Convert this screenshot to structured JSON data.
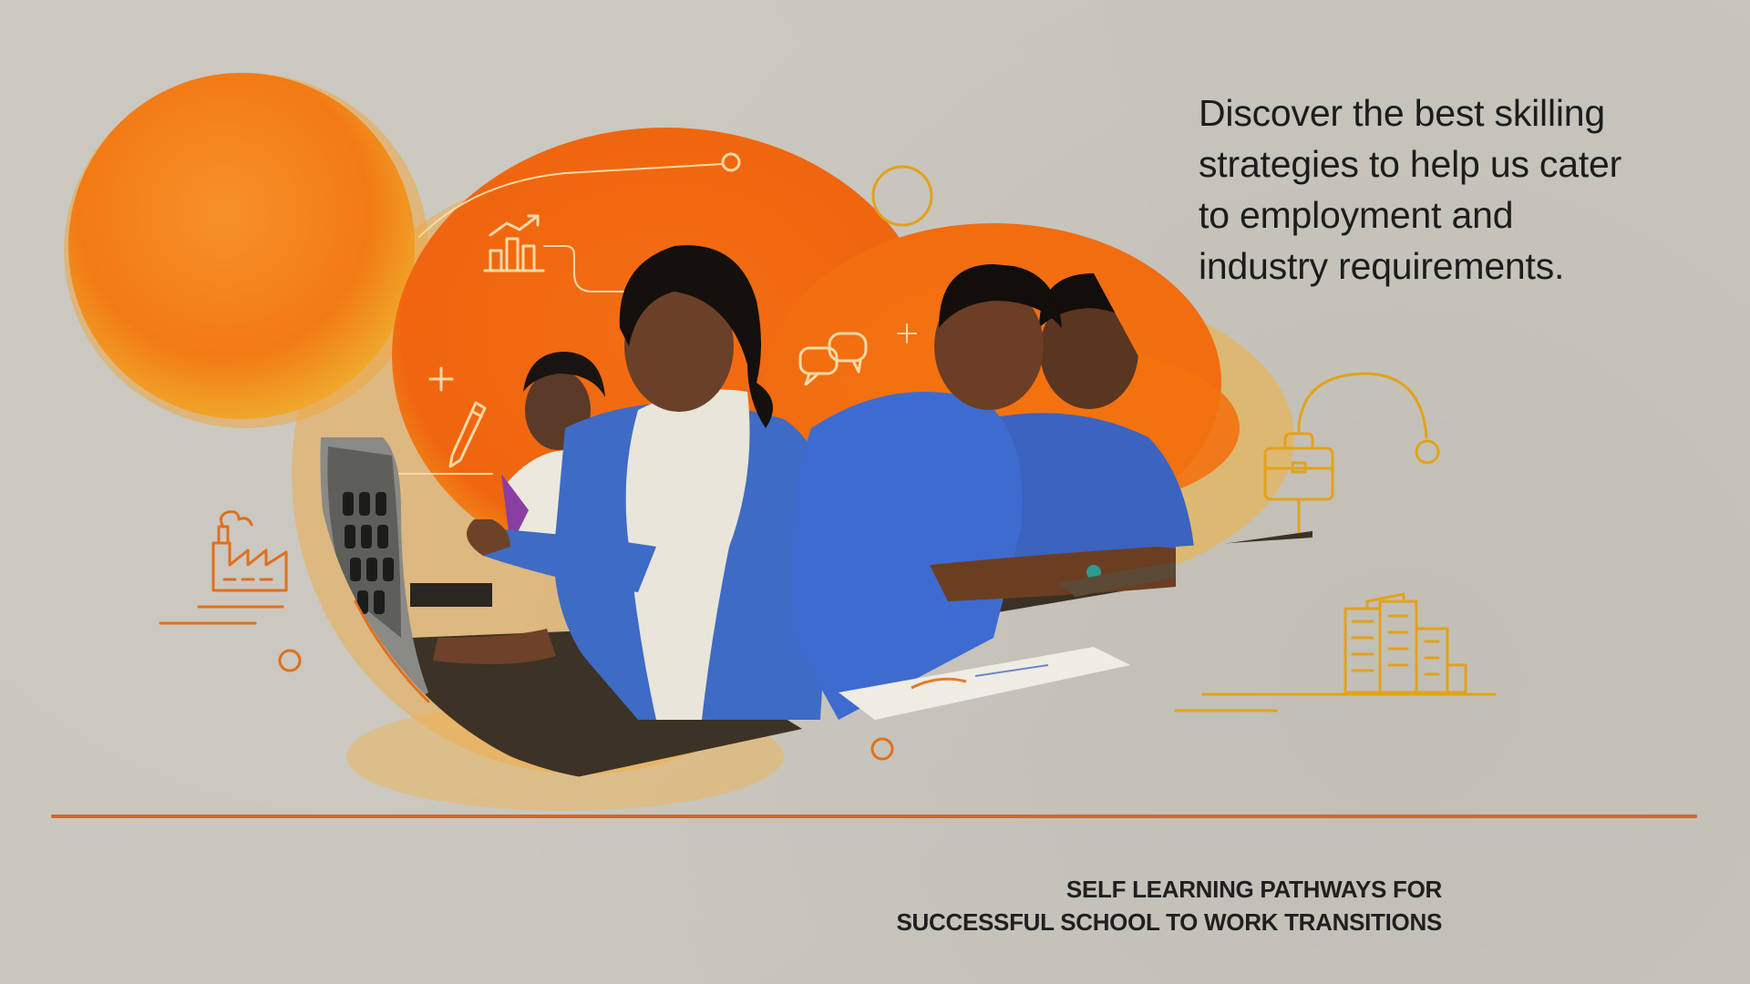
{
  "headline": {
    "line1": "Discover the best skilling",
    "line2": "strategies to help us cater",
    "line3": "to employment and",
    "line4": "industry requirements."
  },
  "footer": {
    "line1": "SELF LEARNING PATHWAYS FOR",
    "line2": "SUCCESSFUL SCHOOL TO WORK TRANSITIONS"
  },
  "colors": {
    "background": "#c9c6be",
    "accent_orange": "#f06a13",
    "icon_gold": "#e3a21a",
    "divider": "#d9661f",
    "text": "#1c1c1c"
  },
  "icons": [
    "growth-chart-icon",
    "speech-bubbles-icon",
    "pencil-icon",
    "plus-icon",
    "factory-icon",
    "briefcase-icon",
    "office-buildings-icon"
  ],
  "photo": "students in blue uniforms working at vocational training bench"
}
